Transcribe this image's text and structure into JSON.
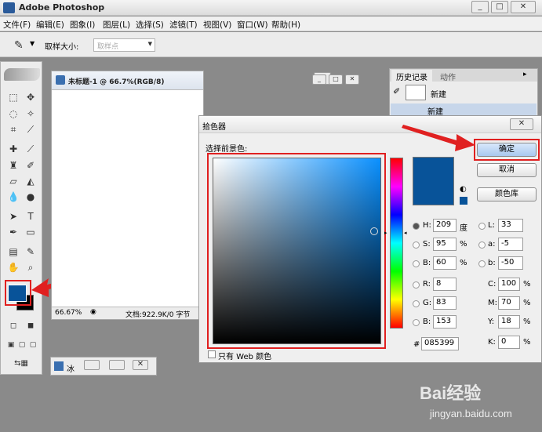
{
  "app": {
    "title": "Adobe Photoshop"
  },
  "menu": [
    "文件(F)",
    "编辑(E)",
    "图象(I)",
    "图层(L)",
    "选择(S)",
    "滤镜(T)",
    "视图(V)",
    "窗口(W)",
    "帮助(H)"
  ],
  "options": {
    "sample_label": "取样大小:",
    "sample_value": "取样点"
  },
  "document": {
    "title": "未标题-1 @ 66.7%(RGB/8)",
    "zoom": "66.67%",
    "doc_info": "文档:922.9K/0 字节"
  },
  "history": {
    "tab_history": "历史记录",
    "tab_actions": "动作",
    "snapshot_label": "新建",
    "step_label": "新建"
  },
  "minimized": {
    "label": "冰"
  },
  "picker": {
    "title": "拾色器",
    "subtitle": "选择前景色:",
    "ok": "确定",
    "cancel": "取消",
    "libraries": "颜色库",
    "web_only": "只有 Web 颜色",
    "hsb": {
      "h": "209",
      "s": "95",
      "b": "60",
      "h_unit": "度",
      "s_unit": "%",
      "b_unit": "%"
    },
    "rgb": {
      "r": "8",
      "g": "83",
      "b": "153"
    },
    "lab": {
      "l": "33",
      "a": "-5",
      "b": "-50"
    },
    "cmyk": {
      "c": "100",
      "m": "70",
      "y": "18",
      "k": "0",
      "unit": "%"
    },
    "labels": {
      "H": "H:",
      "S": "S:",
      "B": "B:",
      "R": "R:",
      "G": "G:",
      "Bb": "B:",
      "L": "L:",
      "a": "a:",
      "b": "b:",
      "C": "C:",
      "M": "M:",
      "Y": "Y:",
      "K": "K:",
      "hash": "#"
    },
    "hex": "085399",
    "colors": {
      "current": "#085399",
      "hue_base": "#0a90ff"
    }
  },
  "watermark": {
    "brand": "Bai经验",
    "url": "jingyan.baidu.com"
  }
}
